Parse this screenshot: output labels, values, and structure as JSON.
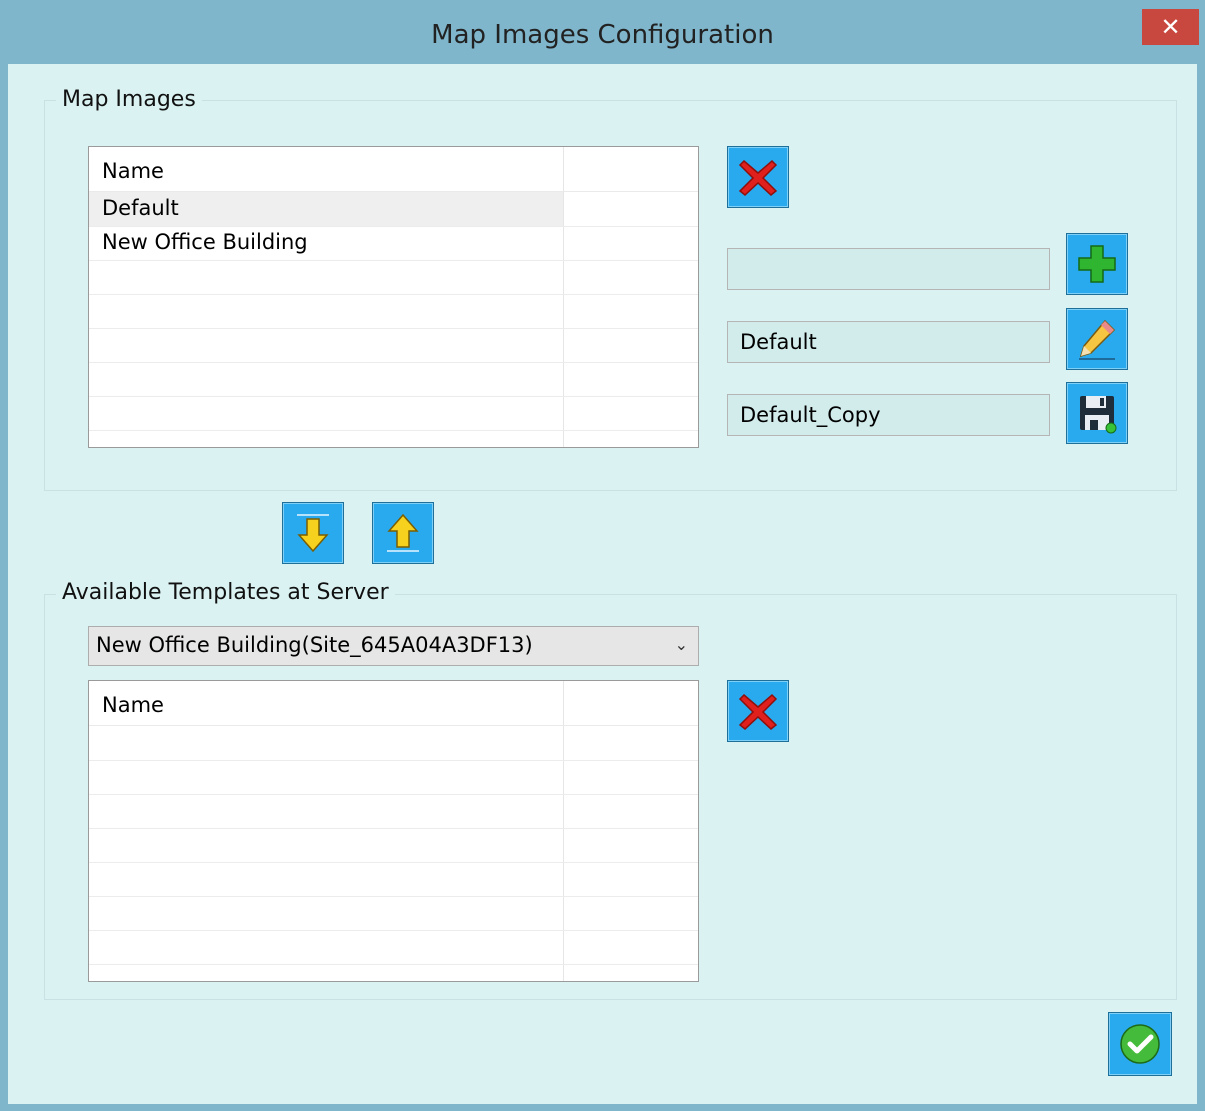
{
  "window": {
    "title": "Map Images Configuration",
    "close_label": "✕"
  },
  "map_images": {
    "group_label": "Map Images",
    "column_name": "Name",
    "rows": [
      "Default",
      "New Office Building",
      "",
      "",
      "",
      "",
      ""
    ],
    "selected_index": 0,
    "new_name_value": "",
    "rename_value": "Default",
    "copy_value": "Default_Copy"
  },
  "templates": {
    "group_label": "Available Templates at Server",
    "selected_site": "New Office Building(Site_645A04A3DF13)",
    "column_name": "Name",
    "rows": [
      "",
      "",
      "",
      "",
      "",
      "",
      ""
    ]
  },
  "icons": {
    "delete": "red-x-icon",
    "add": "green-plus-icon",
    "rename": "pencil-icon",
    "save_copy": "floppy-disk-icon",
    "move_down": "arrow-down-icon",
    "move_up": "arrow-up-icon",
    "ok": "green-check-icon"
  },
  "colors": {
    "title_bar": "#7fb6cb",
    "client": "#daf2f2",
    "button": "#29aaee",
    "close": "#c8473e"
  }
}
